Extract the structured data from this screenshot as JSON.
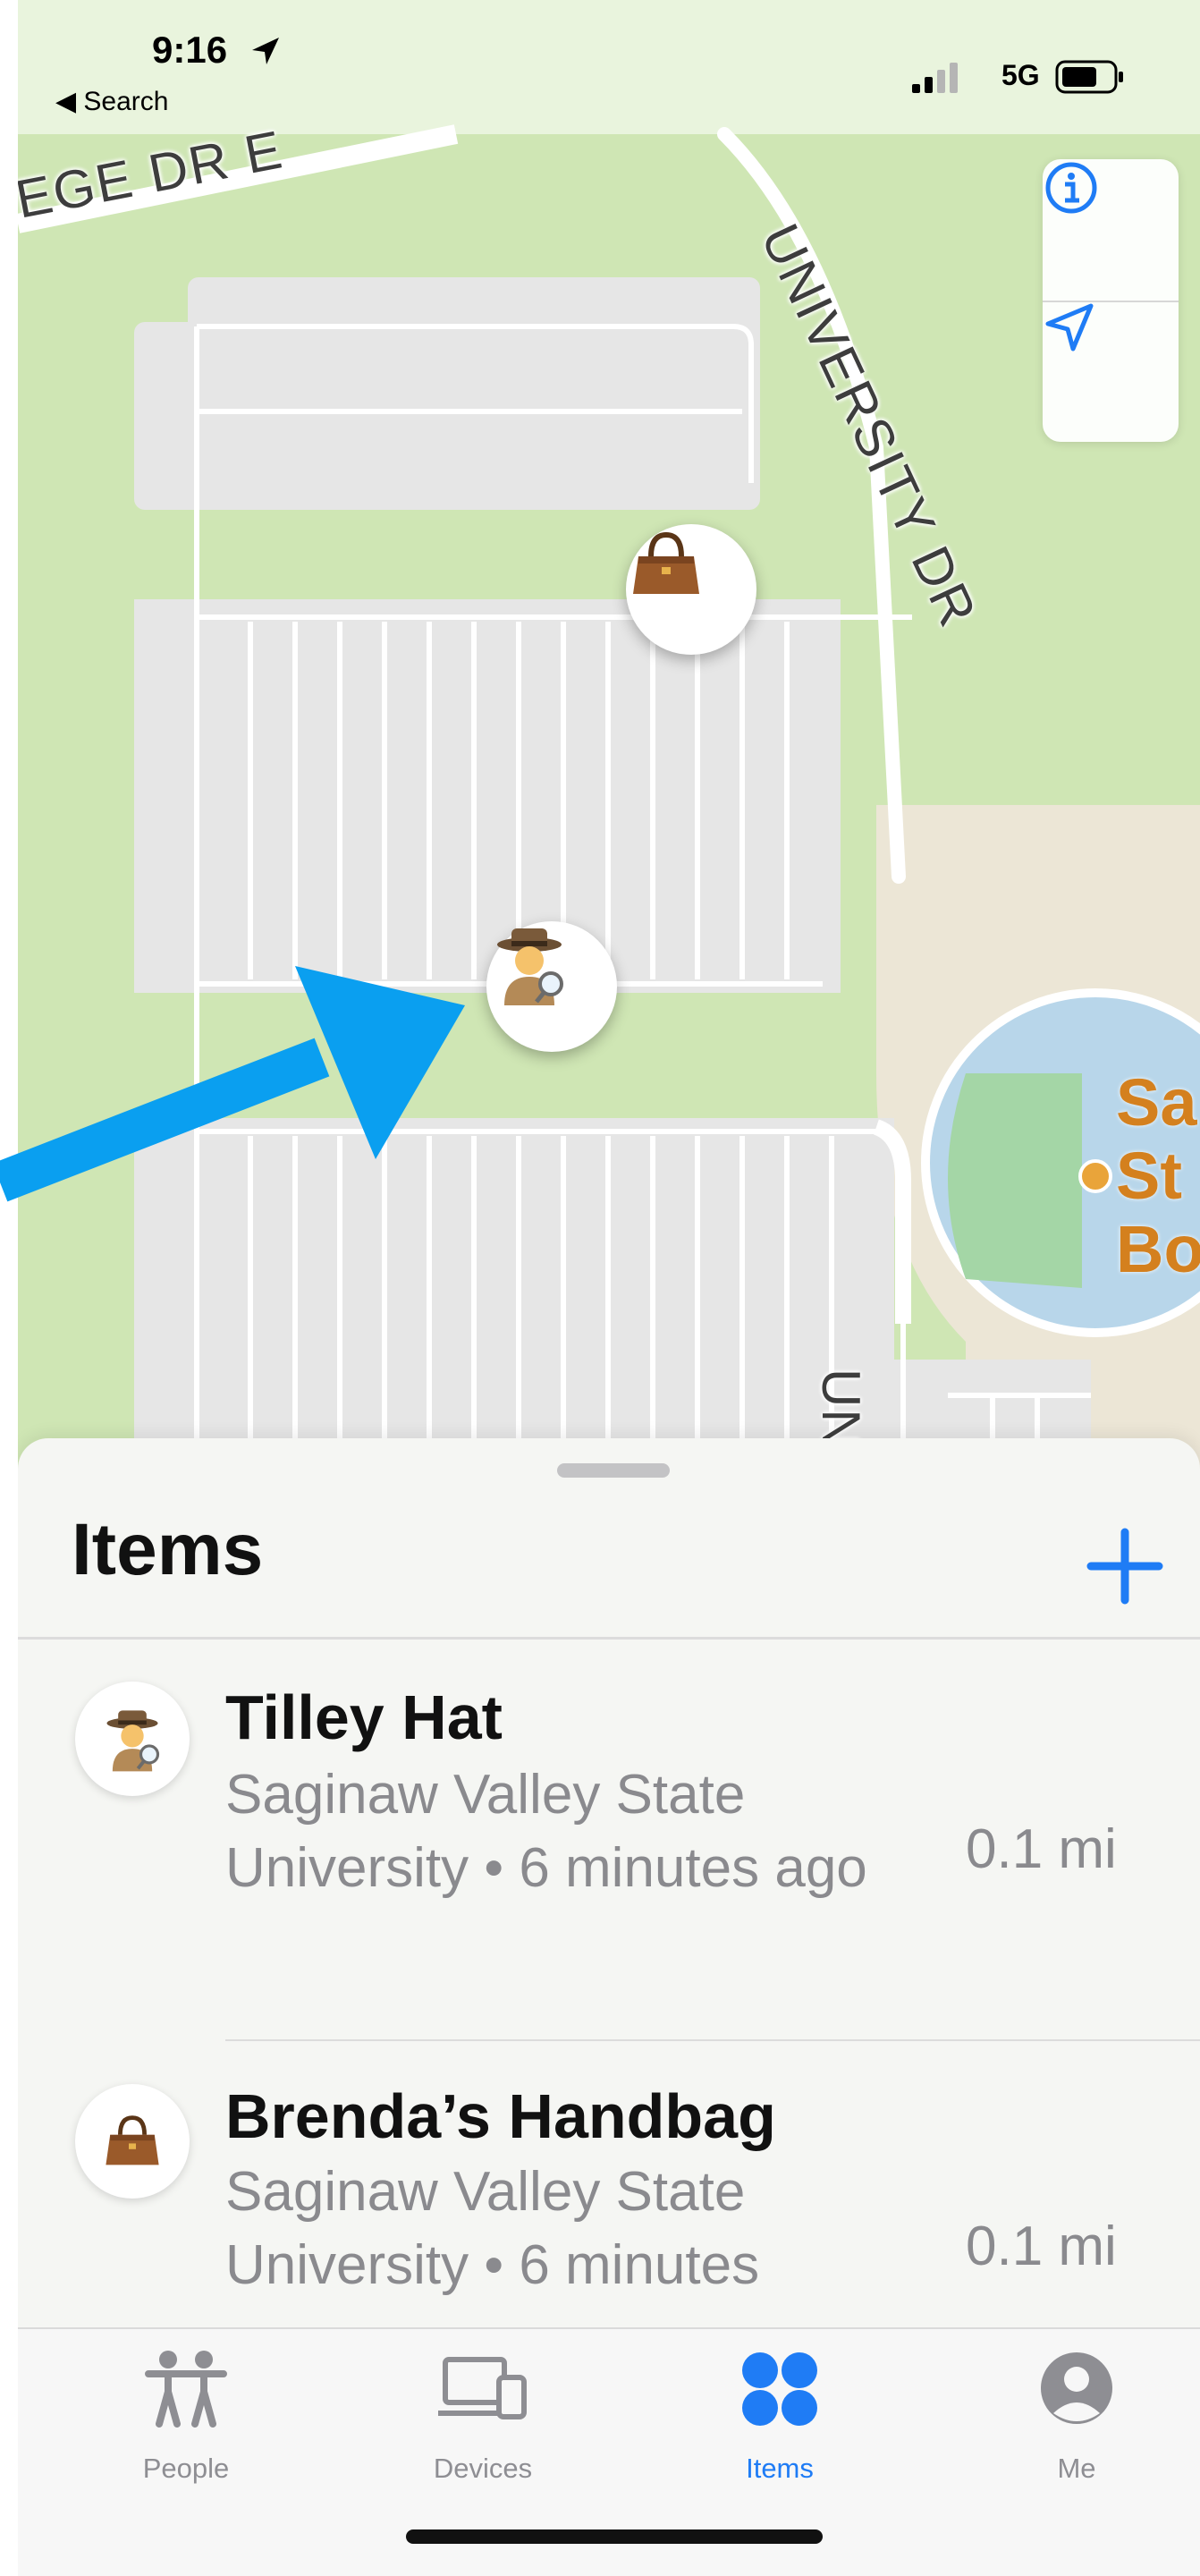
{
  "status_bar": {
    "time": "9:16",
    "back_label": "◀ Search",
    "network": "5G"
  },
  "map": {
    "roads": {
      "college": "EGE DR E",
      "university": "UNIVERSITY DR",
      "un": "UN"
    },
    "poi_label": "Sa\nSt\nBo",
    "pins": [
      {
        "icon": "handbag-icon",
        "emoji": "👜"
      },
      {
        "icon": "detective-icon",
        "emoji": "🕵️"
      }
    ],
    "controls": [
      "info-icon",
      "location-arrow-icon"
    ]
  },
  "sheet": {
    "title": "Items",
    "add_icon": "plus-icon",
    "items": [
      {
        "name": "Tilley Hat",
        "location": "Saginaw Valley State University • 6 minutes ago",
        "distance": "0.1 mi",
        "emoji": "🕵️"
      },
      {
        "name": "Brenda’s Handbag",
        "location": "Saginaw Valley State University • 6 minutes",
        "distance": "0.1 mi",
        "emoji": "👜"
      }
    ]
  },
  "tab_bar": {
    "tabs": [
      {
        "label": "People",
        "icon": "people-icon",
        "active": false
      },
      {
        "label": "Devices",
        "icon": "devices-icon",
        "active": false
      },
      {
        "label": "Items",
        "icon": "items-icon",
        "active": true
      },
      {
        "label": "Me",
        "icon": "person-icon",
        "active": false
      }
    ]
  },
  "colors": {
    "accent": "#1f7cf5",
    "map_grass": "#cfe6b4",
    "poi": "#d4801e",
    "arrow": "#0a9ff0"
  }
}
